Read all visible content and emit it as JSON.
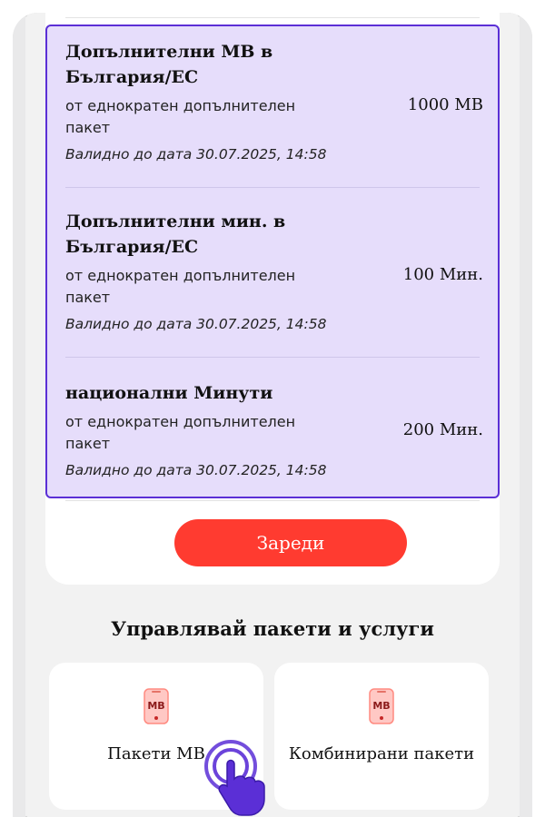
{
  "packages": [
    {
      "title": "Допълнителни MB в България/ЕС",
      "subtitle": "от еднократен допълнителен пакет",
      "validity": "Валидно до дата 30.07.2025, 14:58",
      "amount": "1000 MB"
    },
    {
      "title": "Допълнителни мин. в България/ЕС",
      "subtitle": "от еднократен допълнителен пакет",
      "validity": "Валидно до дата 30.07.2025, 14:58",
      "amount": "100 Мин."
    },
    {
      "title": "национални Минути",
      "subtitle": "от еднократен допълнителен пакет",
      "validity": "Валидно до дата 30.07.2025, 14:58",
      "amount": "200 Мин."
    }
  ],
  "recharge_button": "Зареди",
  "manage_section": {
    "title": "Управлявай пакети и услуги",
    "tiles": [
      {
        "label": "Пакети МВ",
        "icon_text": "MB"
      },
      {
        "label": "Комбинирани пакети",
        "icon_text": "MB"
      }
    ]
  },
  "colors": {
    "accent": "#ff3b30",
    "highlight": "#5b2fd6",
    "highlight_bg": "#e6ddfb"
  }
}
